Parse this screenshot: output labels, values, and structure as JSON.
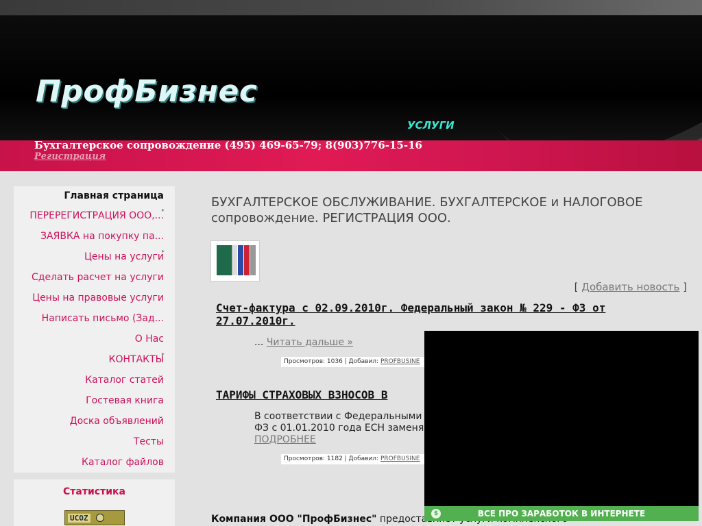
{
  "header": {
    "logo": "ПрофБизнес",
    "services_link": "УСЛУГИ",
    "tagline": "Бухгалтерское сопровождение (495) 469-65-79; 8(903)776-15-16",
    "registration_link": "Регистрация"
  },
  "sidebar": {
    "items": [
      {
        "label": "Главная страница"
      },
      {
        "label": "ПЕРЕРЕГИСТРАЦИЯ ООО,..."
      },
      {
        "label": "ЗАЯВКА на покупку па..."
      },
      {
        "label": "Цены на услуги"
      },
      {
        "label": "Сделать расчет на услуги"
      },
      {
        "label": "Цены на правовые услуги"
      },
      {
        "label": "Написать письмо (Зад..."
      },
      {
        "label": "О Нас"
      },
      {
        "label": "КОНТАКТЫ"
      },
      {
        "label": "Каталог статей"
      },
      {
        "label": "Гостевая книга"
      },
      {
        "label": "Доска объявлений"
      },
      {
        "label": "Тесты"
      },
      {
        "label": "Каталог файлов"
      }
    ],
    "stats_title": "Статистика",
    "ucoz_badge": "UCOZ"
  },
  "main": {
    "title_line1": "БУХГАЛТЕРСКОЕ ОБСЛУЖИВАНИЕ. БУХГАЛТЕРСКОЕ и НАЛОГОВОЕ",
    "title_line2": "сопровождение. РЕГИСТРАЦИЯ ООО.",
    "add_news_open": "[ ",
    "add_news_label": "Добавить новость",
    "add_news_close": " ]",
    "news": [
      {
        "title_line1": "Счет-фактура с 02.09.2010г. Федеральный закон № 229 - ФЗ от",
        "title_line2": "27.07.2010г.",
        "body_prefix": "... ",
        "read_more": "Читать дальше »",
        "meta_prefix": "Просмотров: 1036 | Добавил: ",
        "meta_author": "PROFBUSINE"
      },
      {
        "title_line1": "ТАРИФЫ СТРАХОВЫХ ВЗНОСОВ В",
        "body_line1": "В соответствии с Федеральными",
        "body_line2": "ФЗ с 01.01.2010 года ЕСН заменя",
        "read_more": "ПОДРОБНЕЕ",
        "meta_prefix": "Просмотров: 1182 | Добавил: ",
        "meta_author": "PROFBUSINE"
      }
    ],
    "company_bold": "Компания ООО \"ПрофБизнес\"",
    "company_rest": " предоставляет услуги комплексного"
  },
  "overlay": {
    "bar_icon": "$",
    "bar_label": "ВСЕ ПРО ЗАРАБОТОК В ИНТЕРНЕТЕ"
  },
  "colors": {
    "accent_pink": "#d0105a",
    "overlay_green": "#52b050",
    "logo": "#dff6f6",
    "services": "#38e6d0"
  }
}
